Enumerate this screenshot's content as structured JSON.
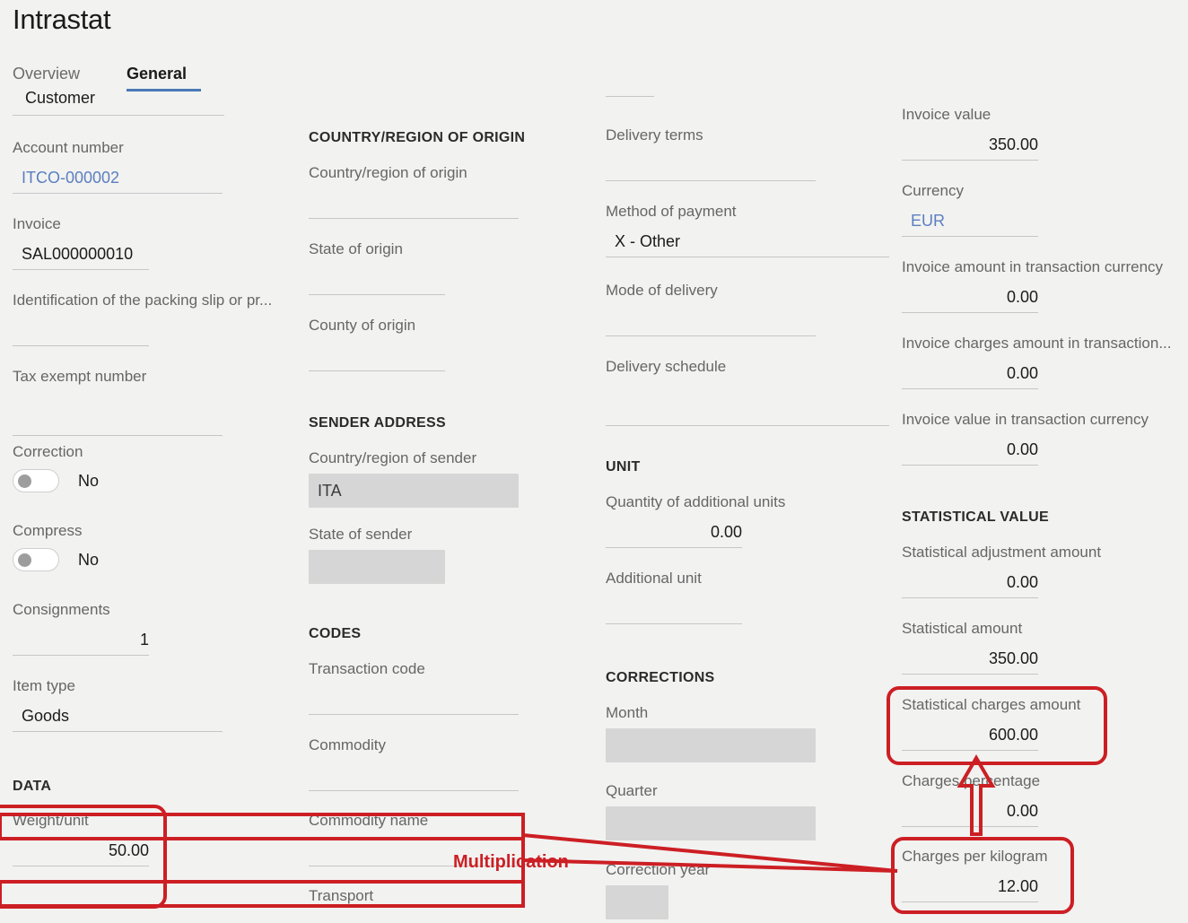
{
  "page": {
    "title": "Intrastat"
  },
  "tabs": {
    "overview_label": "Overview",
    "general_label": "General",
    "selected_value": "Customer"
  },
  "accent_colors": {
    "tab_underline": "#4a7ab5",
    "link": "#5b7fbe",
    "annotation": "#cc1f24",
    "background": "#f2f2f1",
    "disabled_field": "#d6d6d6"
  },
  "column1": {
    "fields": [
      {
        "label": "Account number",
        "value": "ITCO-000002",
        "kind": "link"
      },
      {
        "label": "Invoice",
        "value": "SAL000000010",
        "kind": "text"
      },
      {
        "label": "Identification of the packing slip or pr...",
        "value": "",
        "kind": "text"
      },
      {
        "label": "Tax exempt number",
        "value": "",
        "kind": "text"
      }
    ],
    "toggles": [
      {
        "label": "Correction",
        "state": "No"
      },
      {
        "label": "Compress",
        "state": "No"
      }
    ],
    "fields2": [
      {
        "label": "Consignments",
        "value": "1",
        "kind": "num"
      },
      {
        "label": "Item type",
        "value": "Goods",
        "kind": "text"
      }
    ],
    "data_section": {
      "heading": "DATA",
      "fields": [
        {
          "label": "Weight/unit",
          "value": "50.00",
          "kind": "num"
        }
      ]
    }
  },
  "column2": {
    "origin_section": {
      "heading": "COUNTRY/REGION OF ORIGIN",
      "fields": [
        {
          "label": "Country/region of origin",
          "value": "",
          "kind": "text"
        },
        {
          "label": "State of origin",
          "value": "",
          "kind": "text"
        },
        {
          "label": "County of origin",
          "value": "",
          "kind": "text"
        }
      ]
    },
    "sender_section": {
      "heading": "SENDER ADDRESS",
      "fields": [
        {
          "label": "Country/region of sender",
          "value": "ITA",
          "kind": "disabled"
        },
        {
          "label": "State of sender",
          "value": "",
          "kind": "disabled"
        }
      ]
    },
    "codes_section": {
      "heading": "CODES",
      "fields": [
        {
          "label": "Transaction code",
          "value": "",
          "kind": "text"
        },
        {
          "label": "Commodity",
          "value": "",
          "kind": "text"
        },
        {
          "label": "Commodity name",
          "value": "",
          "kind": "text"
        },
        {
          "label": "Transport",
          "value": "",
          "kind": "text"
        }
      ]
    }
  },
  "column3": {
    "fields": [
      {
        "label": "Delivery terms",
        "value": "",
        "kind": "text"
      },
      {
        "label": "Method of payment",
        "value": "X - Other",
        "kind": "text"
      },
      {
        "label": "Mode of delivery",
        "value": "",
        "kind": "text"
      },
      {
        "label": "Delivery schedule",
        "value": "",
        "kind": "text"
      }
    ],
    "unit_section": {
      "heading": "UNIT",
      "fields": [
        {
          "label": "Quantity of additional units",
          "value": "0.00",
          "kind": "num"
        },
        {
          "label": "Additional unit",
          "value": "",
          "kind": "text"
        }
      ]
    },
    "corrections_section": {
      "heading": "CORRECTIONS",
      "fields": [
        {
          "label": "Month",
          "value": "",
          "kind": "disabled"
        },
        {
          "label": "Quarter",
          "value": "",
          "kind": "disabled"
        },
        {
          "label": "Correction year",
          "value": "",
          "kind": "disabled"
        }
      ]
    }
  },
  "column4": {
    "fields": [
      {
        "label": "Invoice value",
        "value": "350.00",
        "kind": "num"
      },
      {
        "label": "Currency",
        "value": "EUR",
        "kind": "link"
      },
      {
        "label": "Invoice amount in transaction currency",
        "value": "0.00",
        "kind": "num"
      },
      {
        "label": "Invoice charges amount in transaction...",
        "value": "0.00",
        "kind": "num"
      },
      {
        "label": "Invoice value in transaction currency",
        "value": "0.00",
        "kind": "num"
      }
    ],
    "statistical_section": {
      "heading": "STATISTICAL VALUE",
      "fields": [
        {
          "label": "Statistical adjustment amount",
          "value": "0.00",
          "kind": "num"
        },
        {
          "label": "Statistical amount",
          "value": "350.00",
          "kind": "num"
        },
        {
          "label": "Statistical charges amount",
          "value": "600.00",
          "kind": "num"
        },
        {
          "label": "Charges percentage",
          "value": "0.00",
          "kind": "num"
        },
        {
          "label": "Charges per kilogram",
          "value": "12.00",
          "kind": "num"
        }
      ]
    }
  },
  "annotations": {
    "multiplication_label": "Multiplication",
    "highlighted_fields": [
      "Weight/unit",
      "Statistical charges amount",
      "Charges per kilogram"
    ]
  }
}
